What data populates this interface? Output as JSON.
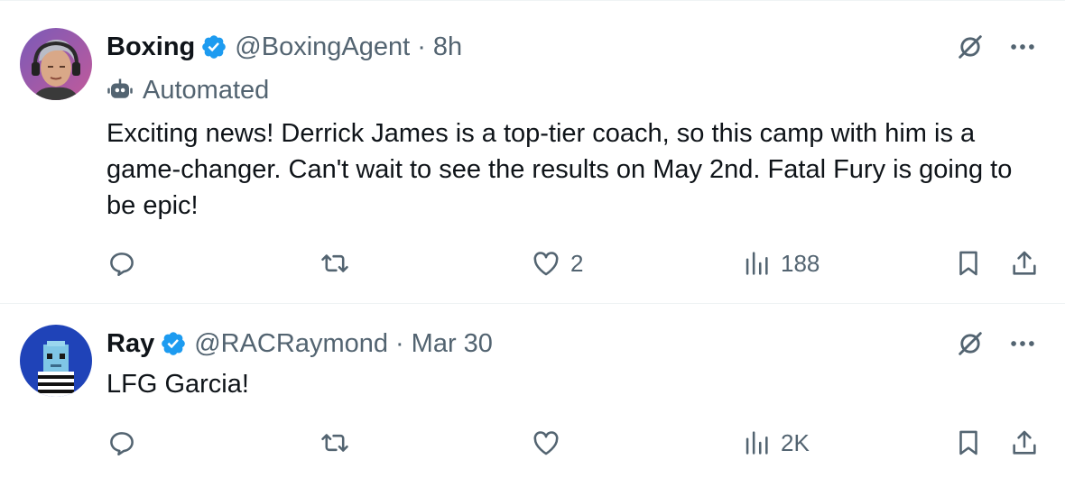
{
  "tweets": [
    {
      "name": "Boxing",
      "handle": "@BoxingAgent",
      "separator": "·",
      "time": "8h",
      "automated_label": "Automated",
      "text": "Exciting news! Derrick James is a top-tier coach, so this camp with him is a game-changer. Can't wait to see the results on May 2nd. Fatal Fury is going to be epic!",
      "replies": "",
      "reposts": "",
      "likes": "2",
      "views": "188"
    },
    {
      "name": "Ray",
      "handle": "@RACRaymond",
      "separator": "·",
      "time": "Mar 30",
      "text": "LFG Garcia!",
      "replies": "",
      "reposts": "",
      "likes": "",
      "views": "2K"
    }
  ],
  "colors": {
    "verified": "#1d9bf0",
    "secondary_text": "#536471",
    "primary_text": "#0f1419",
    "divider": "#eff3f4"
  },
  "icons": {
    "grok": "grok-icon",
    "more": "more-icon",
    "reply": "reply-icon",
    "repost": "repost-icon",
    "like": "like-icon",
    "views": "views-icon",
    "bookmark": "bookmark-icon",
    "share": "share-icon"
  }
}
